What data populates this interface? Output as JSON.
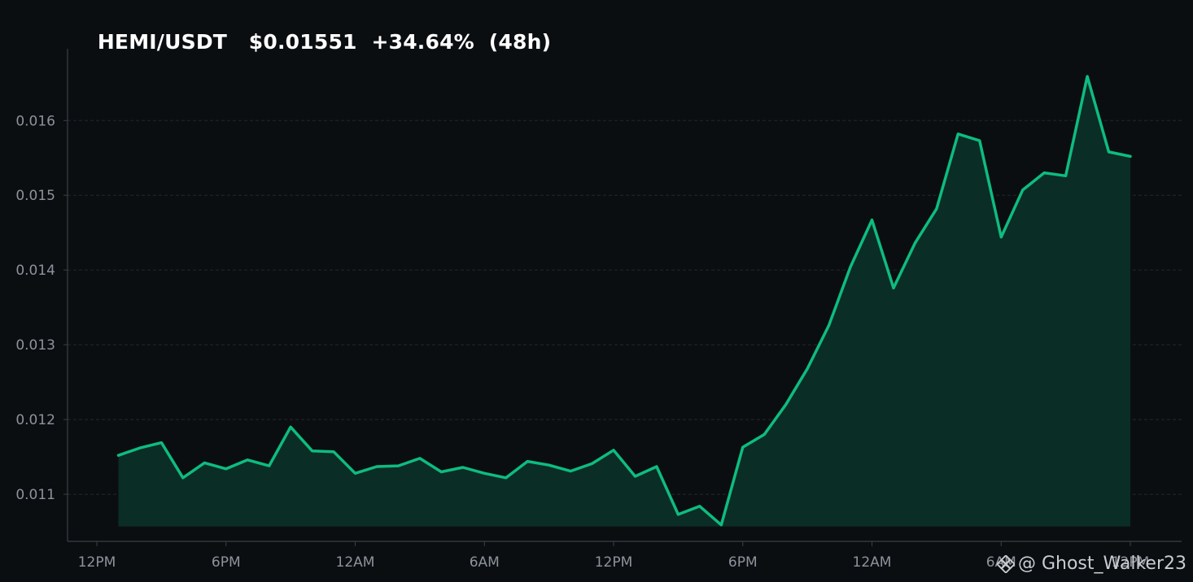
{
  "header": {
    "pair": "HEMI/USDT",
    "price": "$0.01551",
    "change": "+34.64%",
    "period": "(48h)"
  },
  "watermark": {
    "text": "@ Ghost_Walker23",
    "icon": "binance-logo-icon"
  },
  "colors": {
    "background": "#0b0e11",
    "line": "#0ebc7f",
    "fill": "#0a2d26",
    "grid": "#23272d",
    "axis": "#3a3f46",
    "tick_text": "#8d939c"
  },
  "chart_data": {
    "type": "area",
    "title": "HEMI/USDT $0.01551 +34.64% (48h)",
    "xlabel": "",
    "ylabel": "",
    "x_tick_labels": [
      "12PM",
      "6PM",
      "12AM",
      "6AM",
      "12PM",
      "6PM",
      "12AM",
      "6AM",
      "12PM"
    ],
    "x_range_hours": [
      0,
      48
    ],
    "y_ticks": [
      0.011,
      0.012,
      0.013,
      0.014,
      0.015,
      0.016
    ],
    "ylim": [
      0.01037,
      0.01696
    ],
    "fill_baseline": 0.01057,
    "grid": "horizontal dashed",
    "legend": "none",
    "series": [
      {
        "name": "HEMI/USDT",
        "hours": [
          1,
          2,
          3,
          4,
          5,
          6,
          7,
          8,
          9,
          10,
          11,
          12,
          13,
          14,
          15,
          16,
          17,
          18,
          19,
          20,
          21,
          22,
          23,
          24,
          25,
          26,
          27,
          28,
          29,
          30,
          31,
          32,
          33,
          34,
          35,
          36,
          37,
          38,
          39,
          40,
          41,
          42,
          43,
          44,
          45,
          46,
          47,
          48
        ],
        "values": [
          0.01152,
          0.01162,
          0.01169,
          0.01122,
          0.01142,
          0.01134,
          0.01146,
          0.01138,
          0.0119,
          0.01158,
          0.01157,
          0.01128,
          0.01137,
          0.01138,
          0.01148,
          0.0113,
          0.01136,
          0.01128,
          0.01122,
          0.01144,
          0.01139,
          0.01131,
          0.01141,
          0.01159,
          0.01124,
          0.01137,
          0.01073,
          0.01084,
          0.01059,
          0.01163,
          0.0118,
          0.0122,
          0.01268,
          0.01326,
          0.01404,
          0.01467,
          0.01376,
          0.01436,
          0.01482,
          0.01582,
          0.01573,
          0.01444,
          0.01507,
          0.0153,
          0.01526,
          0.01659,
          0.01558,
          0.01552
        ]
      }
    ]
  }
}
